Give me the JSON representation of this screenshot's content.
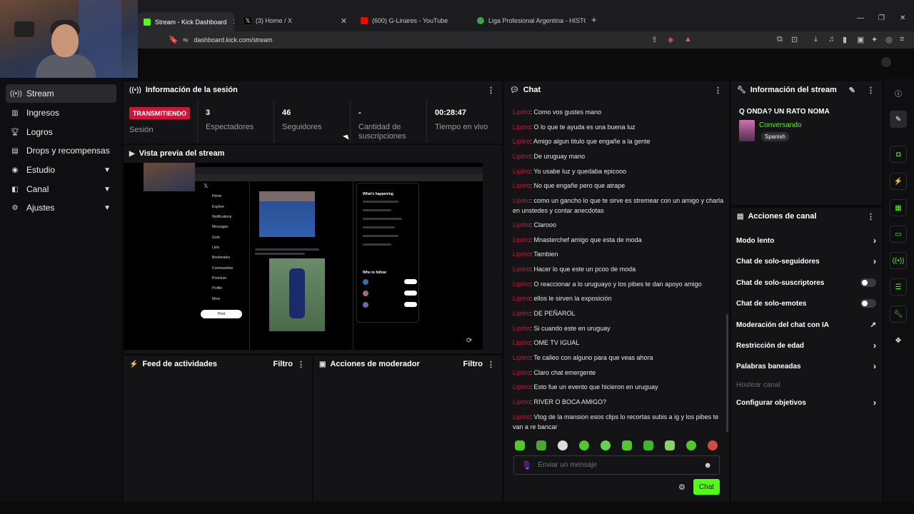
{
  "browser": {
    "tabs": [
      {
        "title": "Stream - Kick Dashboard",
        "active": true
      },
      {
        "title": "(3) Home / X",
        "active": false
      },
      {
        "title": "(600) G-Linares - YouTube",
        "active": false
      },
      {
        "title": "Liga Profesional Argentina - HISTORI",
        "active": false
      }
    ],
    "url": "dashboard.kick.com/stream"
  },
  "sidebar": {
    "items": [
      {
        "label": "Stream",
        "icon": "broadcast-icon"
      },
      {
        "label": "Ingresos",
        "icon": "revenue-icon"
      },
      {
        "label": "Logros",
        "icon": "trophy-icon"
      },
      {
        "label": "Drops y recompensas",
        "icon": "gift-icon"
      },
      {
        "label": "Estudio",
        "icon": "studio-icon"
      },
      {
        "label": "Canal",
        "icon": "channel-icon"
      },
      {
        "label": "Ajustes",
        "icon": "gear-icon"
      }
    ]
  },
  "session": {
    "title": "Información de la sesión",
    "status_badge": "TRANSMITIENDO",
    "status_label": "Sesión",
    "viewers_value": "3",
    "viewers_label": "Espectadores",
    "followers_value": "46",
    "followers_label": "Seguidores",
    "subs_value": "-",
    "subs_label": "Cantidad de suscripciones",
    "uptime_value": "00:28:47",
    "uptime_label": "Tiempo en vivo"
  },
  "preview": {
    "title": "Vista previa del stream",
    "x_nav": [
      "Home",
      "Explore",
      "Notifications",
      "Messages",
      "Grok",
      "Lists",
      "Bookmarks",
      "Communities",
      "Premium",
      "Profile",
      "More"
    ],
    "x_post": "Post",
    "x_trends_title": "What's happening",
    "x_follow_title": "Who to follow"
  },
  "activity": {
    "title": "Feed de actividades",
    "filter": "Filtro"
  },
  "moderator": {
    "title": "Acciones de moderador",
    "filter": "Filtro"
  },
  "chat": {
    "title": "Chat",
    "messages": [
      {
        "user": "Lipitro",
        "text": "Como vos gustes mano"
      },
      {
        "user": "Lipitro",
        "text": "O lo que te ayuda es una buena luz"
      },
      {
        "user": "Lipitro",
        "text": "Amigo algun titulo que engañe a la gente"
      },
      {
        "user": "Lipitro",
        "text": "De uruguay mano"
      },
      {
        "user": "Lipitro",
        "text": "Yo usabe luz y quedaba epicooo"
      },
      {
        "user": "Lipitro",
        "text": "No que engañe pero que atrape"
      },
      {
        "user": "Lipitro",
        "text": "como un gancho lo que te sirve es stremear con un amigo y charla en unstedes y contar anecdotas"
      },
      {
        "user": "Lipitro",
        "text": "Clarooo"
      },
      {
        "user": "Lipitro",
        "text": "Mnasterchef amigo que esta de moda"
      },
      {
        "user": "Lipitro",
        "text": "Tambien"
      },
      {
        "user": "Lipitro",
        "text": "Hacer lo que este un pcoo de moda"
      },
      {
        "user": "Lipitro",
        "text": "O reaccionar a lo uruguayo y los pibes te dan apoyo amigo"
      },
      {
        "user": "Lipitro",
        "text": "ellos le sirven la exposición"
      },
      {
        "user": "Lipitro",
        "text": "DE PEÑAROL"
      },
      {
        "user": "Lipitro",
        "text": "Si cuando este en uruguay"
      },
      {
        "user": "Lipitro",
        "text": "OME TV IGUAL"
      },
      {
        "user": "Lipitro",
        "text": "Te calleo con alguno para que veas ahora"
      },
      {
        "user": "Lipitro",
        "text": "Claro chat emergente"
      },
      {
        "user": "Lipitro",
        "text": "Esto fue un evento que hicieron en uruguay"
      },
      {
        "user": "Lipitro",
        "text": "RIVER O BOCA AMIGO?"
      },
      {
        "user": "Lipitro",
        "text": "Vlog de la mansion esos clips lo recortas subis a ig y los pibes te van a re bancar"
      }
    ],
    "input_placeholder": "Enviar un mensaje",
    "send_label": "Chat"
  },
  "stream_info": {
    "title": "Información del stream",
    "stream_title": "Q ONDA? UN RATO NOMA",
    "category": "Conversando",
    "language_tag": "Spanish"
  },
  "channel_actions": {
    "title": "Acciones de canal",
    "items": [
      {
        "label": "Modo lento",
        "control": "chevron"
      },
      {
        "label": "Chat de solo-seguidores",
        "control": "chevron"
      },
      {
        "label": "Chat de solo-suscriptores",
        "control": "toggle"
      },
      {
        "label": "Chat de solo-emotes",
        "control": "toggle"
      },
      {
        "label": "Moderación del chat con IA",
        "control": "external"
      },
      {
        "label": "Restricción de edad",
        "control": "chevron"
      },
      {
        "label": "Palabras baneadas",
        "control": "chevron"
      },
      {
        "label": "Hostear canal",
        "control": "none"
      },
      {
        "label": "Configurar objetivos",
        "control": "chevron"
      }
    ]
  },
  "colors": {
    "brand_green": "#53fc18",
    "live_red": "#d0143a",
    "chat_username": "#d0143a"
  }
}
